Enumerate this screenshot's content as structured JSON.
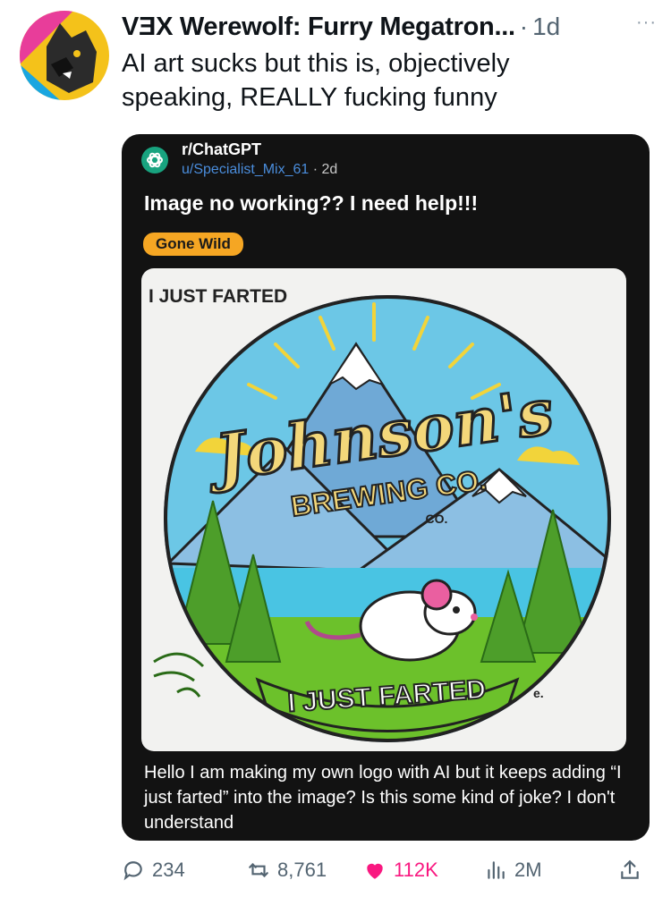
{
  "author": {
    "display_name": "VƎX Werewolf: Furry Megatron...",
    "separator": "·",
    "time": "1d",
    "more": "···"
  },
  "tweet": {
    "text": "AI art sucks but this is, objectively speaking, REALLY fucking funny"
  },
  "reddit_post": {
    "subreddit": "r/ChatGPT",
    "user": "u/Specialist_Mix_61",
    "dot": "·",
    "age": "2d",
    "title": "Image no working?? I need help!!!",
    "flair": "Gone Wild",
    "body": "Hello I am making my own logo with AI but it keeps adding “I just farted” into the image? Is this some kind of joke? I don't understand"
  },
  "logo_image": {
    "corner_text": "I JUST FARTED",
    "brand": "Johnson's",
    "subtitle": "BREWING CO.",
    "small_co": "CO.",
    "banner": "I JUST FARTED",
    "mark": "e.",
    "colors": {
      "sky": "#6cc7e6",
      "mountain": "#6fa9d6",
      "snow": "#ffffff",
      "water": "#49c4e3",
      "grass": "#6cc12b",
      "tree": "#4d9e2a",
      "sun": "#f2d43a",
      "text_fill": "#f3d77a",
      "outline": "#222222",
      "mouse_ear": "#ea5fa0"
    }
  },
  "actions": {
    "replies": "234",
    "reposts": "8,761",
    "likes": "112K",
    "views": "2M"
  },
  "colors": {
    "accent_like": "#f91880",
    "muted": "#536471",
    "flair": "#f5a623",
    "reddit_link": "#4a8ddc",
    "openai_green": "#18a37f"
  }
}
